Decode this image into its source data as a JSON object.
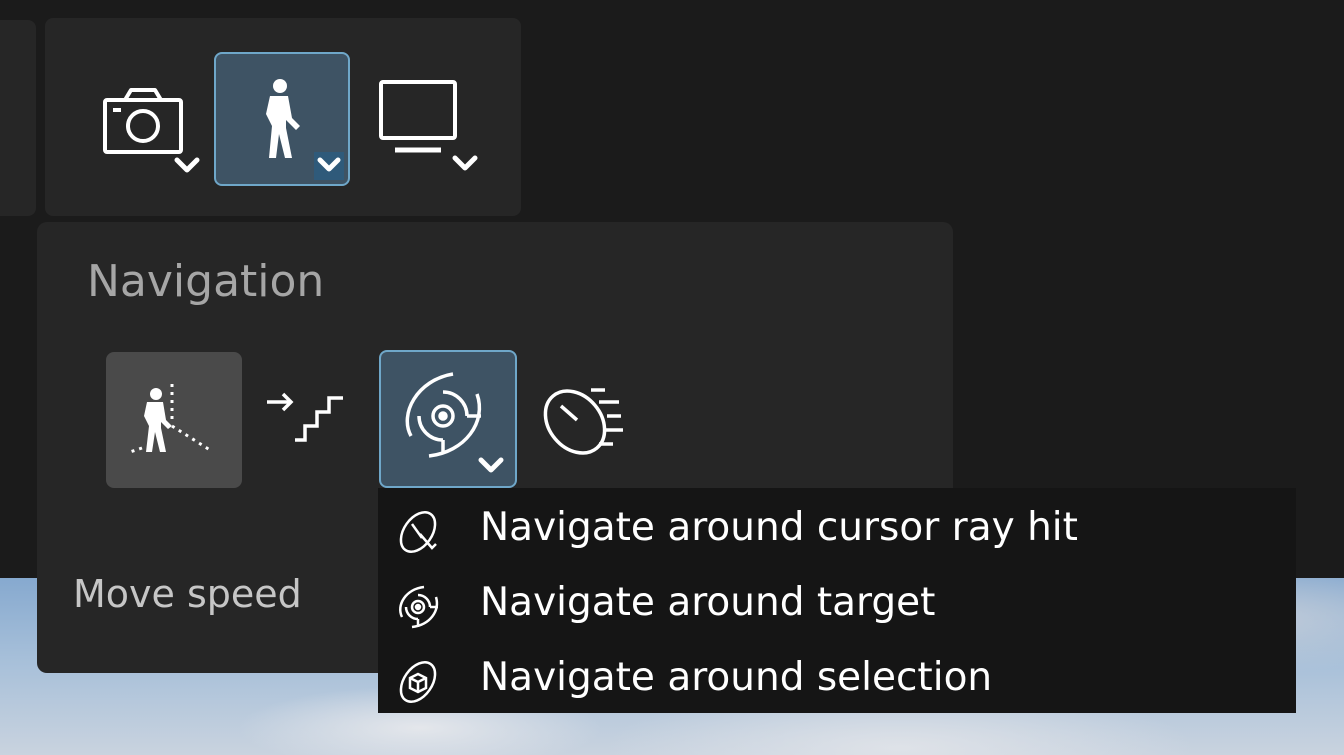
{
  "toolbar": {
    "buttons": [
      {
        "name": "camera",
        "icon": "camera-icon",
        "has_dropdown": true,
        "active": false
      },
      {
        "name": "navigation-mode",
        "icon": "walking-person-icon",
        "has_dropdown": true,
        "active": true
      },
      {
        "name": "display",
        "icon": "monitor-icon",
        "has_dropdown": true,
        "active": false
      }
    ]
  },
  "navigation_panel": {
    "title": "Navigation",
    "tools": [
      {
        "name": "walk-with-gravity",
        "icon": "walk-gravity-icon",
        "state": "pressed"
      },
      {
        "name": "stairs",
        "icon": "stairs-icon",
        "state": "normal"
      },
      {
        "name": "orbit-target",
        "icon": "orbit-target-icon",
        "state": "active",
        "has_dropdown": true
      },
      {
        "name": "mouse-speed",
        "icon": "mouse-speed-icon",
        "state": "normal"
      }
    ],
    "move_speed_label": "Move speed"
  },
  "orbit_dropdown": {
    "items": [
      {
        "label": "Navigate around cursor ray hit",
        "icon": "orbit-cursor-ray-icon"
      },
      {
        "label": "Navigate around target",
        "icon": "orbit-target-icon"
      },
      {
        "label": "Navigate around selection",
        "icon": "orbit-selection-icon"
      }
    ]
  },
  "colors": {
    "background": "#1b1b1b",
    "panel": "#262626",
    "active_fill": "#3e5364",
    "active_border": "#6fa7c9",
    "dropdown": "#151515",
    "title_text": "#a6a6a6",
    "item_text": "#ffffff"
  }
}
